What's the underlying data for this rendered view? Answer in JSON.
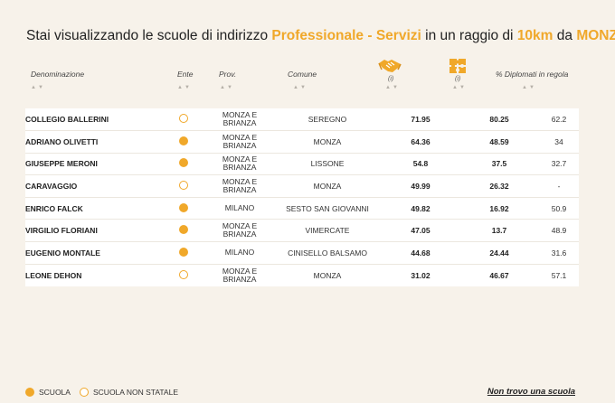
{
  "title": {
    "prefix": "Stai visualizzando le scuole di indirizzo",
    "indirizzo": "Professionale - Servizi",
    "middle": "in un raggio di",
    "raggio": "10km",
    "da": "da",
    "city": "MONZA"
  },
  "columns": {
    "denominazione": "Denominazione",
    "ente": "Ente",
    "prov": "Prov.",
    "comune": "Comune",
    "col1_info": "(i)",
    "col2_info": "(i)",
    "col1_icon": "handshake-icon",
    "col2_icon": "puzzle-icon",
    "diplomati": "% Diplomati in regola",
    "sort_arrows": "▲▼"
  },
  "rows": [
    {
      "name": "COLLEGIO BALLERINI",
      "statale": false,
      "prov": [
        "MONZA E",
        "BRIANZA"
      ],
      "comune": "SEREGNO",
      "v1": "71.95",
      "v2": "80.25",
      "v3": "62.2"
    },
    {
      "name": "ADRIANO OLIVETTI",
      "statale": true,
      "prov": [
        "MONZA E",
        "BRIANZA"
      ],
      "comune": "MONZA",
      "v1": "64.36",
      "v2": "48.59",
      "v3": "34"
    },
    {
      "name": "GIUSEPPE MERONI",
      "statale": true,
      "prov": [
        "MONZA E",
        "BRIANZA"
      ],
      "comune": "LISSONE",
      "v1": "54.8",
      "v2": "37.5",
      "v3": "32.7"
    },
    {
      "name": "CARAVAGGIO",
      "statale": false,
      "prov": [
        "MONZA E",
        "BRIANZA"
      ],
      "comune": "MONZA",
      "v1": "49.99",
      "v2": "26.32",
      "v3": "-"
    },
    {
      "name": "ENRICO FALCK",
      "statale": true,
      "prov": [
        "MILANO"
      ],
      "comune": "SESTO SAN GIOVANNI",
      "v1": "49.82",
      "v2": "16.92",
      "v3": "50.9"
    },
    {
      "name": "VIRGILIO FLORIANI",
      "statale": true,
      "prov": [
        "MONZA E",
        "BRIANZA"
      ],
      "comune": "VIMERCATE",
      "v1": "47.05",
      "v2": "13.7",
      "v3": "48.9"
    },
    {
      "name": "EUGENIO MONTALE",
      "statale": true,
      "prov": [
        "MILANO"
      ],
      "comune": "CINISELLO BALSAMO",
      "v1": "44.68",
      "v2": "24.44",
      "v3": "31.6"
    },
    {
      "name": "LEONE DEHON",
      "statale": false,
      "prov": [
        "MONZA E",
        "BRIANZA"
      ],
      "comune": "MONZA",
      "v1": "31.02",
      "v2": "46.67",
      "v3": "57.1"
    }
  ],
  "legend": {
    "statale": "SCUOLA",
    "non_statale": "SCUOLA NON STATALE"
  },
  "link": "Non trovo una scuola",
  "colors": {
    "accent": "#f0a82a",
    "background": "#f7f2ea"
  }
}
